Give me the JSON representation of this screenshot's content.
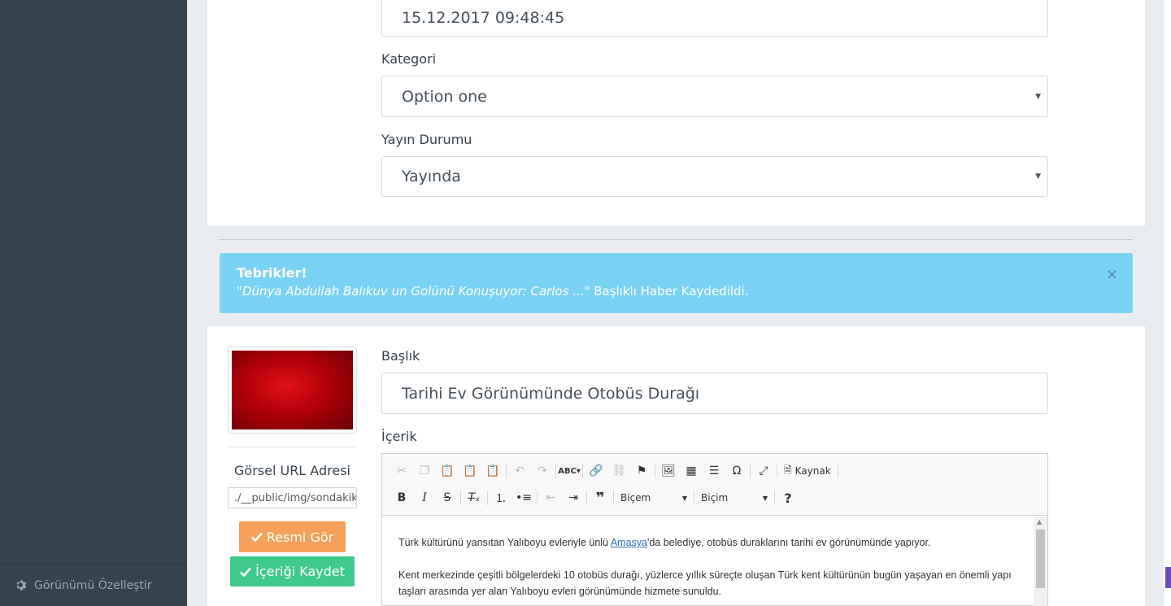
{
  "sidebar": {
    "footer_label": "Görünümü Özelleştir"
  },
  "form_top": {
    "date_value": "15.12.2017 09:48:45",
    "category_label": "Kategori",
    "category_value": "Option one",
    "status_label": "Yayın Durumu",
    "status_value": "Yayında"
  },
  "alert": {
    "title": "Tebrikler!",
    "quoted": "\"Dünya Abdullah Balıkuv un Golünü Konuşuyor: Carlos ...\"",
    "message": " Başlıklı Haber Kaydedildi.",
    "close": "×"
  },
  "image_panel": {
    "url_label": "Görsel URL Adresi",
    "url_value": "./__public/img/sondakika",
    "view_button": "Resmi Gör",
    "save_button": "İçeriği Kaydet"
  },
  "form_main": {
    "title_label": "Başlık",
    "title_value": "Tarihi Ev Görünümünde Otobüs Durağı",
    "content_label": "İçerik"
  },
  "editor": {
    "source_label": "Kaynak",
    "style_combo": "Biçem",
    "format_combo": "Biçim",
    "p1_before": "Türk kültürünü yansıtan Yalıboyu evleriyle ünlü ",
    "p1_link": "Amasya",
    "p1_after": "'da belediye, otobüs duraklarını tarihi ev görünümünde yapıyor.",
    "p2": "Kent merkezinde çeşitli bölgelerdeki 10 otobüs durağı, yüzlerce yıllık süreçte oluşan Türk kent kültürünün bugün yaşayan en önemli yapı taşları arasında yer alan Yalıboyu evleri görünümünde hizmete sunuldu."
  }
}
